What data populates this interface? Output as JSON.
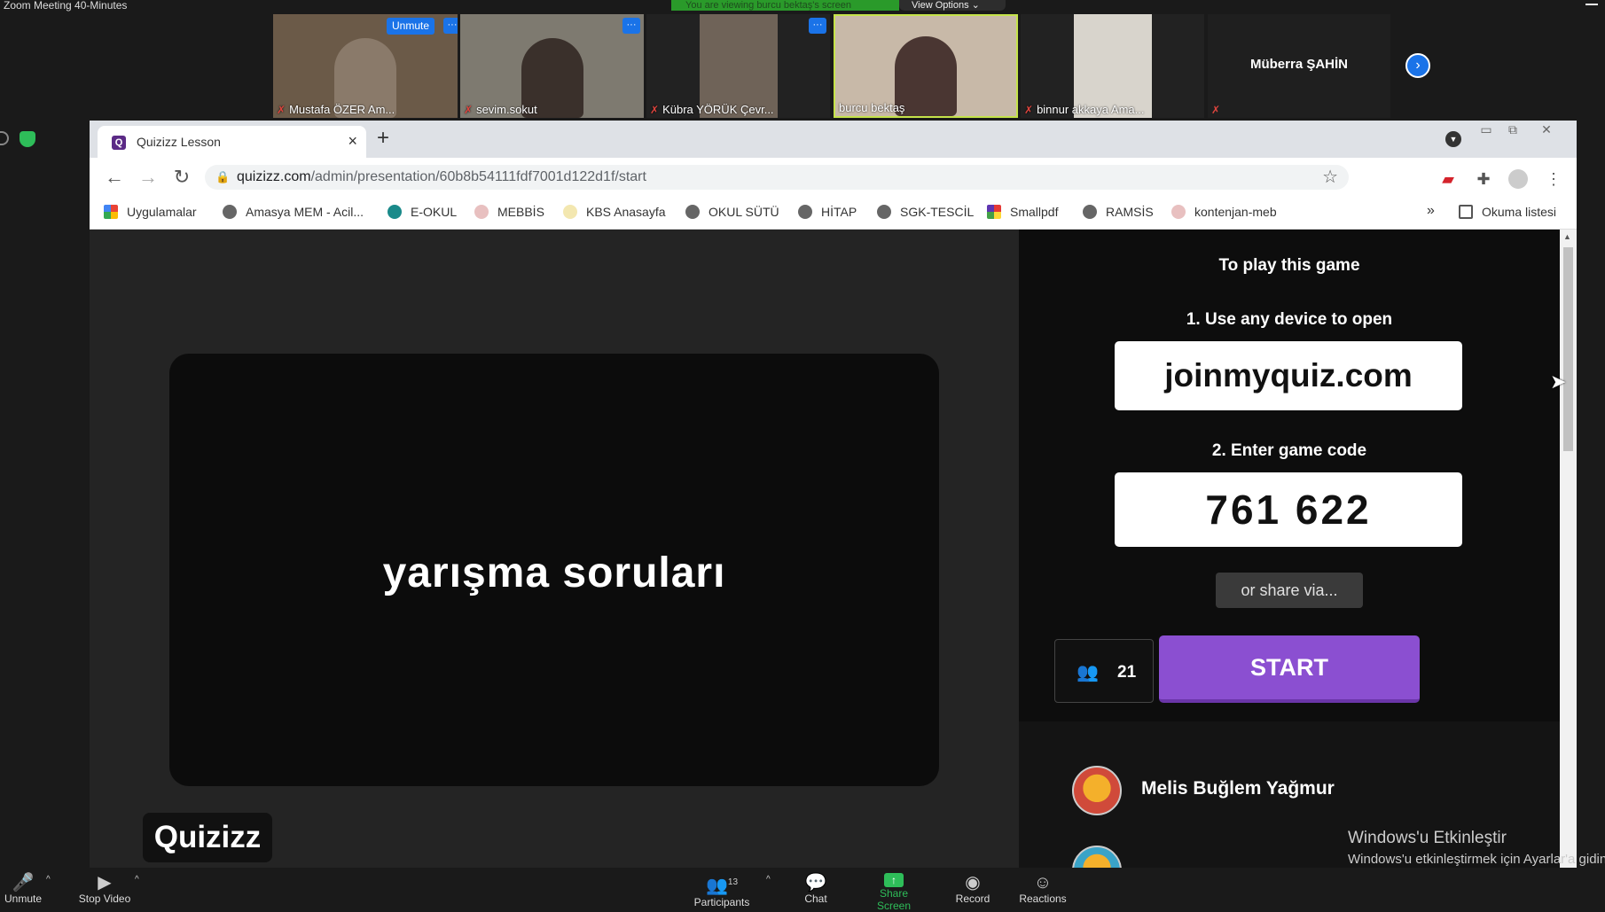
{
  "zoom": {
    "window_title": "Zoom Meeting 40-Minutes",
    "view_banner": "You are viewing burcu bektaş's screen",
    "view_options": "View Options ⌄",
    "participants_strip": [
      {
        "name": "Mustafa ÖZER Am...",
        "unmute_label": "Unmute",
        "more": "···"
      },
      {
        "name": "sevim.sokut",
        "more": "···"
      },
      {
        "name": "Kübra YÖRÜK Çevr...",
        "more": "···"
      },
      {
        "name": "burcu bektaş"
      },
      {
        "name": "binnur akkaya Ama..."
      }
    ],
    "name_only_tile": "Müberra ŞAHİN",
    "toolbar": {
      "unmute": "Unmute",
      "stop_video": "Stop Video",
      "participants": "Participants",
      "participants_count": "13",
      "chat": "Chat",
      "share_screen": "Share Screen",
      "record": "Record",
      "reactions": "Reactions"
    }
  },
  "browser": {
    "tab_title": "Quizizz Lesson",
    "url_host": "quizizz.com",
    "url_path": "/admin/presentation/60b8b54111fdf7001d122d1f/start",
    "bookmarks": [
      "Uygulamalar",
      "Amasya MEM - Acil...",
      "E-OKUL",
      "MEBBİS",
      "KBS Anasayfa",
      "OKUL SÜTÜ",
      "HİTAP",
      "SGK-TESCİL",
      "Smallpdf",
      "RAMSİS",
      "kontenjan-meb"
    ],
    "more_bookmarks": "»",
    "reading_list": "Okuma listesi"
  },
  "quiz": {
    "slide_title": "yarışma soruları",
    "logo": "Quizizz",
    "instructions_heading": "To play this game",
    "step1": "1. Use any device to open",
    "join_url": "joinmyquiz.com",
    "step2": "2. Enter game code",
    "game_code": "761 622",
    "share_via": "or share via...",
    "player_count": "21",
    "start_label": "START",
    "players": [
      "Melis Buğlem Yağmur"
    ]
  },
  "windows_watermark": {
    "line1": "Windows'u Etkinleştir",
    "line2": "Windows'u etkinleştirmek için Ayarlar'a gidin."
  },
  "colors": {
    "start_button": "#8b4fd1",
    "zoom_blue": "#1a73e8",
    "share_green": "#2ebd59"
  }
}
